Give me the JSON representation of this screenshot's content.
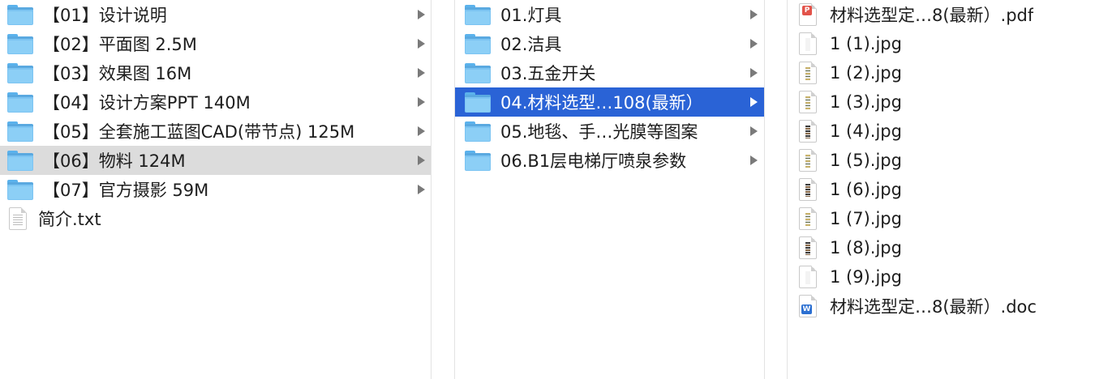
{
  "column1": {
    "items": [
      {
        "label": "【01】设计说明",
        "type": "folder",
        "chevron": true
      },
      {
        "label": "【02】平面图 2.5M",
        "type": "folder",
        "chevron": true
      },
      {
        "label": "【03】效果图 16M",
        "type": "folder",
        "chevron": true
      },
      {
        "label": "【04】设计方案PPT 140M",
        "type": "folder",
        "chevron": true
      },
      {
        "label": "【05】全套施工蓝图CAD(带节点) 125M",
        "type": "folder",
        "chevron": true
      },
      {
        "label": "【06】物料 124M",
        "type": "folder",
        "chevron": true,
        "state": "selected-inactive"
      },
      {
        "label": "【07】官方摄影 59M",
        "type": "folder",
        "chevron": true
      },
      {
        "label": "简介.txt",
        "type": "text-file",
        "chevron": false
      }
    ]
  },
  "column2": {
    "items": [
      {
        "label": "01.灯具",
        "type": "folder",
        "chevron": true
      },
      {
        "label": "02.洁具",
        "type": "folder",
        "chevron": true
      },
      {
        "label": "03.五金开关",
        "type": "folder",
        "chevron": true
      },
      {
        "label": "04.材料选型…108(最新）",
        "type": "folder",
        "chevron": true,
        "state": "selected-active"
      },
      {
        "label": "05.地毯、手…光膜等图案",
        "type": "folder",
        "chevron": true
      },
      {
        "label": "06.B1层电梯厅喷泉参数",
        "type": "folder",
        "chevron": true
      }
    ]
  },
  "column3": {
    "items": [
      {
        "label": "材料选型定…8(最新）.pdf",
        "type": "pdf-file",
        "icon_text": "P"
      },
      {
        "label": "1 (1).jpg",
        "type": "image-file"
      },
      {
        "label": "1 (2).jpg",
        "type": "image-file"
      },
      {
        "label": "1 (3).jpg",
        "type": "image-file"
      },
      {
        "label": "1 (4).jpg",
        "type": "image-file"
      },
      {
        "label": "1 (5).jpg",
        "type": "image-file"
      },
      {
        "label": "1 (6).jpg",
        "type": "image-file"
      },
      {
        "label": "1 (7).jpg",
        "type": "image-file"
      },
      {
        "label": "1 (8).jpg",
        "type": "image-file"
      },
      {
        "label": "1 (9).jpg",
        "type": "image-file"
      },
      {
        "label": "材料选型定…8(最新）.doc",
        "type": "word-file",
        "icon_text": "W"
      }
    ]
  },
  "colors": {
    "selection_active": "#2a63d6",
    "selection_inactive": "#dcdcdc",
    "folder_blue": "#7cc4f2",
    "chevron": "#7a7a7a"
  }
}
